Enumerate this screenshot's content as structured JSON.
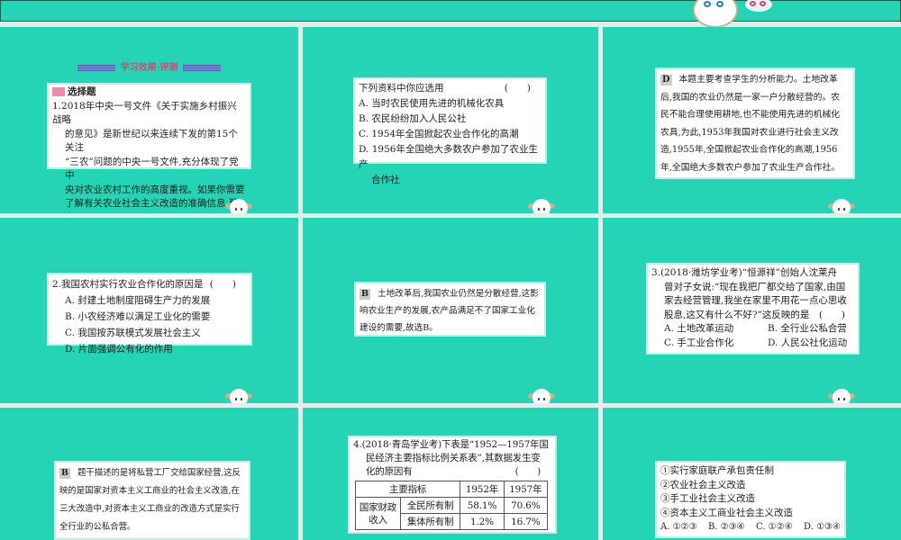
{
  "colors": {
    "slide_bg": "#25d4b5",
    "accent": "#d2497a"
  },
  "slide1": {
    "section_title": "学习效果·评测",
    "section_label": "选择题",
    "text": [
      "1.2018年中央一号文件《关于实施乡村振兴战略",
      "的意见》是新世纪以来连续下发的第15个关注",
      "“三农”问题的中央一号文件,充分体现了党中",
      "央对农业农村工作的高度重视。如果你需要",
      "了解有关农业社会主义改造的准确信息,那么"
    ]
  },
  "slide2": {
    "stem": "下列资料中你应选用",
    "paren": "(　　)",
    "options": [
      "A. 当时农民使用先进的机械化农具",
      "B. 农民纷纷加入人民公社",
      "C. 1954年全国掀起农业合作化的高潮",
      "D. 1956年全国绝大多数农户参加了农业生产"
    ],
    "cont": "合作社"
  },
  "slide3": {
    "answer": "D",
    "text": [
      "本题主要考查学生的分析能力。土地改革",
      "后,我国的农业仍然是一家一户分散经营的。农",
      "民不能合理使用耕地,也不能使用先进的机械化",
      "农具,为此,1953年我国对农业进行社会主义改",
      "造,1955年,全国掀起农业合作化的高潮,1956",
      "年,全国绝大多数农户参加了农业生产合作社。"
    ]
  },
  "slide4": {
    "stem": "2.我国农村实行农业合作化的原因是",
    "paren": "(　　)",
    "options": [
      "A. 封建土地制度阻碍生产力的发展",
      "B. 小农经济难以满足工业化的需要",
      "C. 我国按苏联模式发展社会主义",
      "D. 片面强调公有化的作用"
    ]
  },
  "slide5": {
    "answer": "B",
    "text": [
      "土地改革后,我国农业仍然是分散经营,这影",
      "响农业生产的发展,农产品满足不了国家工业化",
      "建设的需要,故选B。"
    ]
  },
  "slide6": {
    "text": [
      "3.(2018·潍坊学业考)“恒源祥”创始人沈莱舟",
      "曾对子女说:“现在我把厂都交给了国家,由国",
      "家去经营管理,我坐在家里不用花一点心思收",
      "股息,这又有什么不好?”这反映的是　(　　)"
    ],
    "options": [
      "A. 土地改革运动",
      "B. 全行业公私合营",
      "C. 手工业合作化",
      "D. 人民公社化运动"
    ]
  },
  "slide7": {
    "answer": "B",
    "text": [
      "题干描述的是将私营工厂交给国家经营,这反",
      "映的是国家对资本主义工商业的社会主义改造,在",
      "三大改造中,对资本主义工商业的改造方式是实行",
      "全行业的公私合营。"
    ]
  },
  "slide8": {
    "text": [
      "4.(2018·青岛学业考)下表是“1952—1957年国",
      "民经济主要指标比例关系表”,其数据发生变",
      "化的原因有"
    ],
    "paren": "(　　)",
    "table": {
      "headers": [
        "主要指标",
        "1952年",
        "1957年"
      ],
      "group": "国家财政收入",
      "rows": [
        [
          "全民所有制",
          "58.1%",
          "70.6%"
        ],
        [
          "集体所有制",
          "1.2%",
          "16.7%"
        ]
      ]
    }
  },
  "slide9": {
    "items": [
      "①实行家庭联产承包责任制",
      "②农业社会主义改造",
      "③手工业社会主义改造",
      "④资本主义工商业社会主义改造"
    ],
    "options": [
      "A. ①②③",
      "B. ②③④",
      "C. ①②④",
      "D. ①③④"
    ]
  }
}
